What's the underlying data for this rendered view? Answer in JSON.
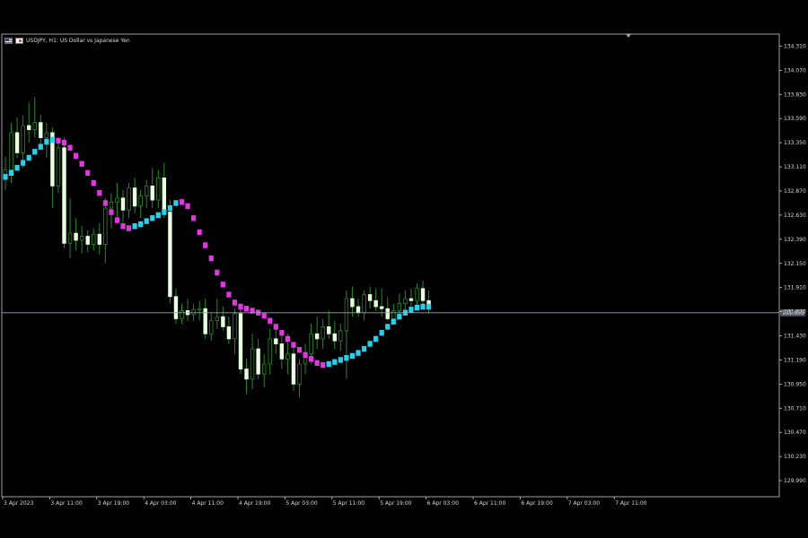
{
  "window": {
    "title": "USDJPY, H1:  US Dollar vs Japanese Yen"
  },
  "colors": {
    "background": "#000000",
    "axis": "#c8c8c8",
    "bull_candle": "#e8ffe0",
    "bear_candle": "#e8ffe0",
    "wick": "#1e8c1e",
    "ma_up": "#22d3ee",
    "ma_down": "#e533e5",
    "bid_line": "#9aa3aa",
    "price_label_bg": "#4b5560"
  },
  "current_price": {
    "label": "131.659",
    "value": 131.659
  },
  "chart_data": {
    "type": "candlestick",
    "title": "USDJPY, H1:  US Dollar vs Japanese Yen",
    "ylim": [
      129.83,
      134.43
    ],
    "y_ticks": [
      "134.310",
      "134.070",
      "133.830",
      "133.590",
      "133.350",
      "133.110",
      "132.870",
      "132.630",
      "132.390",
      "132.150",
      "131.910",
      "131.670",
      "131.430",
      "131.190",
      "130.950",
      "130.710",
      "130.470",
      "130.230",
      "129.990"
    ],
    "x_ticks": [
      "3 Apr 2023",
      "3 Apr 11:00",
      "3 Apr 19:00",
      "4 Apr 03:00",
      "4 Apr 11:00",
      "4 Apr 19:00",
      "5 Apr 03:00",
      "5 Apr 11:00",
      "5 Apr 19:00",
      "6 Apr 03:00",
      "6 Apr 11:00",
      "6 Apr 19:00",
      "7 Apr 03:00",
      "7 Apr 11:00"
    ],
    "candles": [
      {
        "o": 133.01,
        "h": 133.21,
        "l": 132.88,
        "c": 133.08
      },
      {
        "o": 133.08,
        "h": 133.55,
        "l": 132.95,
        "c": 133.45
      },
      {
        "o": 133.45,
        "h": 133.6,
        "l": 133.2,
        "c": 133.25
      },
      {
        "o": 133.25,
        "h": 133.62,
        "l": 133.1,
        "c": 133.52
      },
      {
        "o": 133.52,
        "h": 133.75,
        "l": 133.35,
        "c": 133.48
      },
      {
        "o": 133.48,
        "h": 133.8,
        "l": 133.4,
        "c": 133.55
      },
      {
        "o": 133.55,
        "h": 133.63,
        "l": 133.3,
        "c": 133.4
      },
      {
        "o": 133.4,
        "h": 133.55,
        "l": 133.2,
        "c": 133.45
      },
      {
        "o": 133.45,
        "h": 133.5,
        "l": 132.7,
        "c": 132.92
      },
      {
        "o": 132.92,
        "h": 133.35,
        "l": 132.85,
        "c": 133.3
      },
      {
        "o": 133.3,
        "h": 133.4,
        "l": 132.3,
        "c": 132.35
      },
      {
        "o": 132.35,
        "h": 132.8,
        "l": 132.2,
        "c": 132.45
      },
      {
        "o": 132.45,
        "h": 132.6,
        "l": 132.28,
        "c": 132.38
      },
      {
        "o": 132.38,
        "h": 132.52,
        "l": 132.25,
        "c": 132.42
      },
      {
        "o": 132.42,
        "h": 132.48,
        "l": 132.26,
        "c": 132.34
      },
      {
        "o": 132.34,
        "h": 132.5,
        "l": 132.28,
        "c": 132.44
      },
      {
        "o": 132.44,
        "h": 132.55,
        "l": 132.24,
        "c": 132.34
      },
      {
        "o": 132.34,
        "h": 132.8,
        "l": 132.15,
        "c": 132.7
      },
      {
        "o": 132.7,
        "h": 132.85,
        "l": 132.5,
        "c": 132.76
      },
      {
        "o": 132.76,
        "h": 132.95,
        "l": 132.6,
        "c": 132.8
      },
      {
        "o": 132.8,
        "h": 132.88,
        "l": 132.55,
        "c": 132.68
      },
      {
        "o": 132.68,
        "h": 132.95,
        "l": 132.6,
        "c": 132.9
      },
      {
        "o": 132.9,
        "h": 133.0,
        "l": 132.65,
        "c": 132.72
      },
      {
        "o": 132.72,
        "h": 132.88,
        "l": 132.6,
        "c": 132.82
      },
      {
        "o": 132.82,
        "h": 132.98,
        "l": 132.7,
        "c": 132.92
      },
      {
        "o": 132.92,
        "h": 133.1,
        "l": 132.7,
        "c": 132.78
      },
      {
        "o": 132.78,
        "h": 133.08,
        "l": 132.7,
        "c": 133.0
      },
      {
        "o": 133.0,
        "h": 133.15,
        "l": 132.6,
        "c": 132.66
      },
      {
        "o": 132.66,
        "h": 132.78,
        "l": 131.75,
        "c": 131.82
      },
      {
        "o": 131.82,
        "h": 131.9,
        "l": 131.55,
        "c": 131.6
      },
      {
        "o": 131.6,
        "h": 131.75,
        "l": 131.55,
        "c": 131.68
      },
      {
        "o": 131.68,
        "h": 131.8,
        "l": 131.58,
        "c": 131.64
      },
      {
        "o": 131.64,
        "h": 131.75,
        "l": 131.58,
        "c": 131.69
      },
      {
        "o": 131.69,
        "h": 131.78,
        "l": 131.58,
        "c": 131.7
      },
      {
        "o": 131.7,
        "h": 131.8,
        "l": 131.4,
        "c": 131.45
      },
      {
        "o": 131.45,
        "h": 131.65,
        "l": 131.38,
        "c": 131.58
      },
      {
        "o": 131.58,
        "h": 131.8,
        "l": 131.5,
        "c": 131.62
      },
      {
        "o": 131.62,
        "h": 131.72,
        "l": 131.48,
        "c": 131.52
      },
      {
        "o": 131.52,
        "h": 131.62,
        "l": 131.35,
        "c": 131.4
      },
      {
        "o": 131.4,
        "h": 131.7,
        "l": 131.25,
        "c": 131.65
      },
      {
        "o": 131.65,
        "h": 131.75,
        "l": 131.05,
        "c": 131.1
      },
      {
        "o": 131.1,
        "h": 131.2,
        "l": 130.85,
        "c": 131.0
      },
      {
        "o": 131.0,
        "h": 131.45,
        "l": 130.9,
        "c": 131.3
      },
      {
        "o": 131.3,
        "h": 131.4,
        "l": 131.0,
        "c": 131.05
      },
      {
        "o": 131.05,
        "h": 131.25,
        "l": 130.92,
        "c": 131.15
      },
      {
        "o": 131.15,
        "h": 131.5,
        "l": 131.05,
        "c": 131.4
      },
      {
        "o": 131.4,
        "h": 131.55,
        "l": 131.25,
        "c": 131.35
      },
      {
        "o": 131.35,
        "h": 131.45,
        "l": 131.1,
        "c": 131.2
      },
      {
        "o": 131.2,
        "h": 131.45,
        "l": 131.05,
        "c": 131.25
      },
      {
        "o": 131.25,
        "h": 131.35,
        "l": 130.88,
        "c": 130.95
      },
      {
        "o": 130.95,
        "h": 131.2,
        "l": 130.82,
        "c": 131.15
      },
      {
        "o": 131.15,
        "h": 131.35,
        "l": 131.05,
        "c": 131.25
      },
      {
        "o": 131.25,
        "h": 131.55,
        "l": 131.15,
        "c": 131.45
      },
      {
        "o": 131.45,
        "h": 131.62,
        "l": 131.3,
        "c": 131.4
      },
      {
        "o": 131.4,
        "h": 131.6,
        "l": 131.3,
        "c": 131.52
      },
      {
        "o": 131.52,
        "h": 131.68,
        "l": 131.4,
        "c": 131.45
      },
      {
        "o": 131.45,
        "h": 131.58,
        "l": 131.3,
        "c": 131.38
      },
      {
        "o": 131.38,
        "h": 131.55,
        "l": 131.28,
        "c": 131.48
      },
      {
        "o": 131.48,
        "h": 131.88,
        "l": 131.0,
        "c": 131.8
      },
      {
        "o": 131.8,
        "h": 131.92,
        "l": 131.62,
        "c": 131.72
      },
      {
        "o": 131.72,
        "h": 131.8,
        "l": 131.62,
        "c": 131.66
      },
      {
        "o": 131.66,
        "h": 131.88,
        "l": 131.58,
        "c": 131.84
      },
      {
        "o": 131.84,
        "h": 131.92,
        "l": 131.7,
        "c": 131.78
      },
      {
        "o": 131.78,
        "h": 131.9,
        "l": 131.68,
        "c": 131.72
      },
      {
        "o": 131.72,
        "h": 131.9,
        "l": 131.62,
        "c": 131.7
      },
      {
        "o": 131.7,
        "h": 131.82,
        "l": 131.58,
        "c": 131.6
      },
      {
        "o": 131.6,
        "h": 131.75,
        "l": 131.55,
        "c": 131.68
      },
      {
        "o": 131.68,
        "h": 131.85,
        "l": 131.62,
        "c": 131.75
      },
      {
        "o": 131.75,
        "h": 131.88,
        "l": 131.66,
        "c": 131.8
      },
      {
        "o": 131.8,
        "h": 131.9,
        "l": 131.7,
        "c": 131.78
      },
      {
        "o": 131.78,
        "h": 131.95,
        "l": 131.7,
        "c": 131.9
      },
      {
        "o": 131.9,
        "h": 131.98,
        "l": 131.72,
        "c": 131.78
      },
      {
        "o": 131.78,
        "h": 131.88,
        "l": 131.65,
        "c": 131.7
      }
    ],
    "ma": [
      {
        "v": 133.01,
        "d": "up"
      },
      {
        "v": 133.05,
        "d": "up"
      },
      {
        "v": 133.1,
        "d": "up"
      },
      {
        "v": 133.15,
        "d": "up"
      },
      {
        "v": 133.2,
        "d": "up"
      },
      {
        "v": 133.26,
        "d": "up"
      },
      {
        "v": 133.31,
        "d": "up"
      },
      {
        "v": 133.36,
        "d": "up"
      },
      {
        "v": 133.38,
        "d": "up"
      },
      {
        "v": 133.37,
        "d": "down"
      },
      {
        "v": 133.35,
        "d": "down"
      },
      {
        "v": 133.3,
        "d": "down"
      },
      {
        "v": 133.22,
        "d": "down"
      },
      {
        "v": 133.14,
        "d": "down"
      },
      {
        "v": 133.05,
        "d": "down"
      },
      {
        "v": 132.95,
        "d": "down"
      },
      {
        "v": 132.85,
        "d": "down"
      },
      {
        "v": 132.75,
        "d": "down"
      },
      {
        "v": 132.66,
        "d": "down"
      },
      {
        "v": 132.58,
        "d": "down"
      },
      {
        "v": 132.52,
        "d": "down"
      },
      {
        "v": 132.5,
        "d": "down"
      },
      {
        "v": 132.52,
        "d": "up"
      },
      {
        "v": 132.54,
        "d": "up"
      },
      {
        "v": 132.57,
        "d": "up"
      },
      {
        "v": 132.6,
        "d": "up"
      },
      {
        "v": 132.63,
        "d": "up"
      },
      {
        "v": 132.66,
        "d": "up"
      },
      {
        "v": 132.7,
        "d": "up"
      },
      {
        "v": 132.75,
        "d": "up"
      },
      {
        "v": 132.76,
        "d": "down"
      },
      {
        "v": 132.72,
        "d": "down"
      },
      {
        "v": 132.6,
        "d": "down"
      },
      {
        "v": 132.46,
        "d": "down"
      },
      {
        "v": 132.33,
        "d": "down"
      },
      {
        "v": 132.2,
        "d": "down"
      },
      {
        "v": 132.06,
        "d": "down"
      },
      {
        "v": 131.94,
        "d": "down"
      },
      {
        "v": 131.84,
        "d": "down"
      },
      {
        "v": 131.76,
        "d": "down"
      },
      {
        "v": 131.72,
        "d": "down"
      },
      {
        "v": 131.7,
        "d": "down"
      },
      {
        "v": 131.68,
        "d": "down"
      },
      {
        "v": 131.66,
        "d": "down"
      },
      {
        "v": 131.63,
        "d": "down"
      },
      {
        "v": 131.58,
        "d": "down"
      },
      {
        "v": 131.52,
        "d": "down"
      },
      {
        "v": 131.46,
        "d": "down"
      },
      {
        "v": 131.4,
        "d": "down"
      },
      {
        "v": 131.34,
        "d": "down"
      },
      {
        "v": 131.29,
        "d": "down"
      },
      {
        "v": 131.24,
        "d": "down"
      },
      {
        "v": 131.2,
        "d": "down"
      },
      {
        "v": 131.16,
        "d": "down"
      },
      {
        "v": 131.14,
        "d": "down"
      },
      {
        "v": 131.15,
        "d": "up"
      },
      {
        "v": 131.17,
        "d": "up"
      },
      {
        "v": 131.19,
        "d": "up"
      },
      {
        "v": 131.21,
        "d": "up"
      },
      {
        "v": 131.23,
        "d": "up"
      },
      {
        "v": 131.26,
        "d": "up"
      },
      {
        "v": 131.3,
        "d": "up"
      },
      {
        "v": 131.35,
        "d": "up"
      },
      {
        "v": 131.4,
        "d": "up"
      },
      {
        "v": 131.46,
        "d": "up"
      },
      {
        "v": 131.52,
        "d": "up"
      },
      {
        "v": 131.57,
        "d": "up"
      },
      {
        "v": 131.62,
        "d": "up"
      },
      {
        "v": 131.66,
        "d": "up"
      },
      {
        "v": 131.69,
        "d": "up"
      },
      {
        "v": 131.71,
        "d": "up"
      },
      {
        "v": 131.72,
        "d": "up"
      },
      {
        "v": 131.72,
        "d": "up"
      }
    ]
  }
}
